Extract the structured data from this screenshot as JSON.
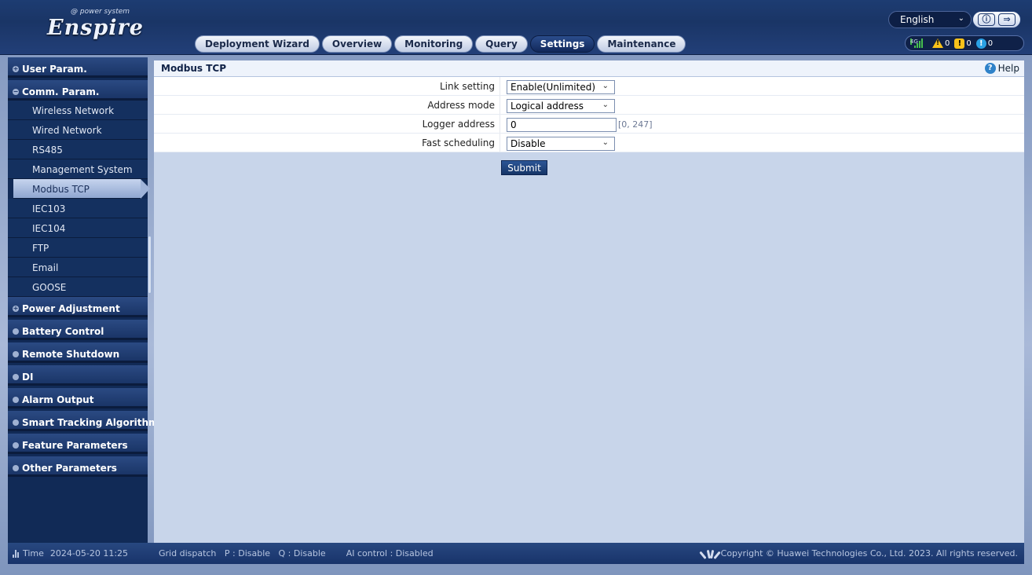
{
  "app": {
    "logo_text": "Enspire",
    "logo_tagline": "@ power system"
  },
  "header": {
    "language": "English",
    "tabs": [
      {
        "label": "Deployment Wizard",
        "active": false
      },
      {
        "label": "Overview",
        "active": false
      },
      {
        "label": "Monitoring",
        "active": false
      },
      {
        "label": "Query",
        "active": false
      },
      {
        "label": "Settings",
        "active": true
      },
      {
        "label": "Maintenance",
        "active": false
      }
    ],
    "signal_label": "4G",
    "alarm_major_count": "0",
    "alarm_minor_count": "0",
    "alarm_warning_count": "0"
  },
  "sidebar": {
    "groups": [
      {
        "label": "User Param.",
        "expanded": false
      },
      {
        "label": "Comm. Param.",
        "expanded": true
      }
    ],
    "items": [
      {
        "label": "Wireless Network"
      },
      {
        "label": "Wired Network"
      },
      {
        "label": "RS485"
      },
      {
        "label": "Management System"
      },
      {
        "label": "Modbus TCP",
        "active": true
      },
      {
        "label": "IEC103"
      },
      {
        "label": "IEC104"
      },
      {
        "label": "FTP"
      },
      {
        "label": "Email"
      },
      {
        "label": "GOOSE"
      }
    ],
    "groups_after": [
      {
        "label": "Power Adjustment"
      },
      {
        "label": "Battery Control"
      },
      {
        "label": "Remote Shutdown"
      },
      {
        "label": "DI"
      },
      {
        "label": "Alarm Output"
      },
      {
        "label": "Smart Tracking Algorithm"
      },
      {
        "label": "Feature Parameters"
      },
      {
        "label": "Other Parameters"
      }
    ]
  },
  "main": {
    "title": "Modbus TCP",
    "help_label": "Help",
    "form": {
      "link_setting": {
        "label": "Link setting",
        "value": "Enable(Unlimited)"
      },
      "address_mode": {
        "label": "Address mode",
        "value": "Logical address"
      },
      "logger_address": {
        "label": "Logger address",
        "value": "0",
        "range": "[0, 247]"
      },
      "fast_scheduling": {
        "label": "Fast scheduling",
        "value": "Disable"
      }
    },
    "submit_label": "Submit"
  },
  "footer": {
    "time_label": "Time",
    "time_value": "2024-05-20 11:25",
    "grid_dispatch": "Grid dispatch   P : Disable   Q : Disable",
    "ai_control": "AI control : Disabled",
    "copyright": "Copyright © Huawei Technologies Co., Ltd. 2023. All rights reserved."
  }
}
